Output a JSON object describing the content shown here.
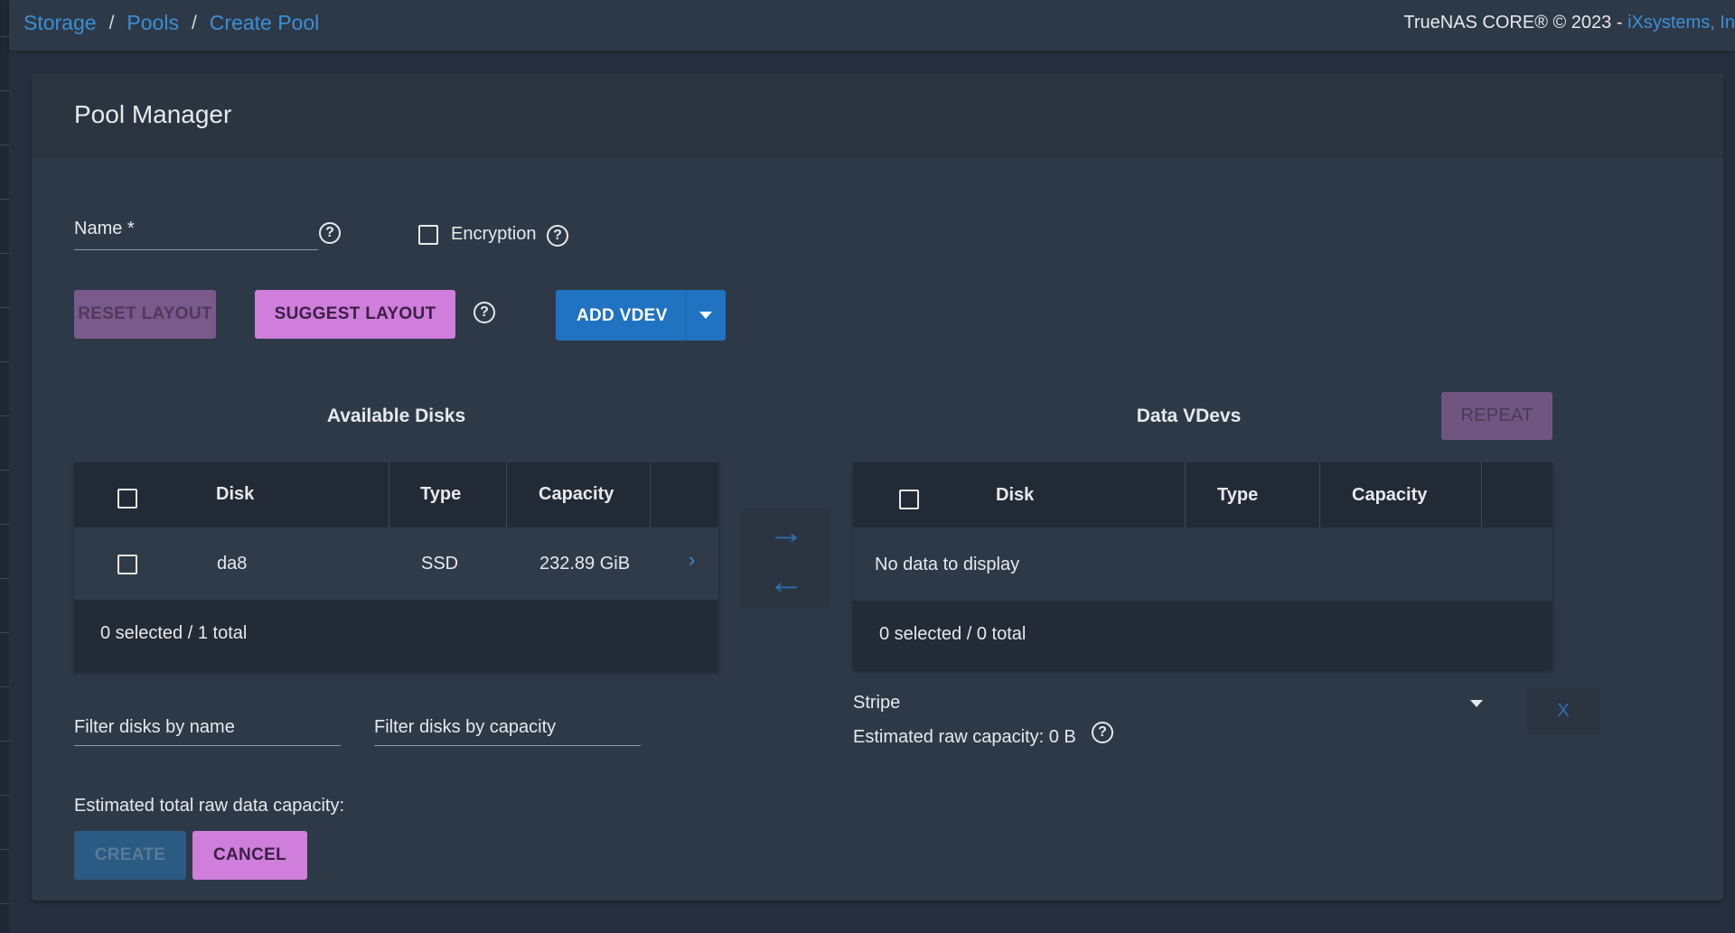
{
  "breadcrumb": {
    "storage": "Storage",
    "pools": "Pools",
    "current": "Create Pool",
    "separator": "/"
  },
  "footer_brand": {
    "text": "TrueNAS CORE® © 2023 - ",
    "link": "iXsystems, In"
  },
  "card": {
    "title": "Pool Manager"
  },
  "form": {
    "name_label": "Name *",
    "encryption_label": "Encryption",
    "help_glyph": "?"
  },
  "buttons": {
    "reset_layout": "RESET LAYOUT",
    "suggest_layout": "SUGGEST LAYOUT",
    "add_vdev": "ADD VDEV",
    "repeat": "REPEAT",
    "create": "CREATE",
    "cancel": "CANCEL",
    "remove_vdev": "X"
  },
  "available_disks": {
    "title": "Available Disks",
    "columns": [
      "Disk",
      "Type",
      "Capacity"
    ],
    "rows": [
      {
        "disk": "da8",
        "type": "SSD",
        "capacity": "232.89 GiB",
        "expand": "›"
      }
    ],
    "footer": "0 selected / 1 total",
    "filter_name_placeholder": "Filter disks by name",
    "filter_capacity_placeholder": "Filter disks by capacity"
  },
  "data_vdevs": {
    "title": "Data VDevs",
    "columns": [
      "Disk",
      "Type",
      "Capacity"
    ],
    "empty_message": "No data to display",
    "footer": "0 selected / 0 total",
    "layout_value": "Stripe",
    "estimated_capacity": "Estimated raw capacity: 0 B"
  },
  "transfer": {
    "right_arrow": "→",
    "left_arrow": "←"
  },
  "estimated_total": "Estimated total raw data capacity:",
  "icons": [
    "help-icon",
    "checkbox-icon",
    "dropdown-caret-icon",
    "arrow-right-icon",
    "arrow-left-icon",
    "chevron-right-icon"
  ],
  "colors": {
    "accent_blue": "#1f73c0",
    "link_blue": "#3b8fd6",
    "accent_pink": "#cf7edc",
    "background": "#262f3d",
    "card": "#2e3947"
  }
}
